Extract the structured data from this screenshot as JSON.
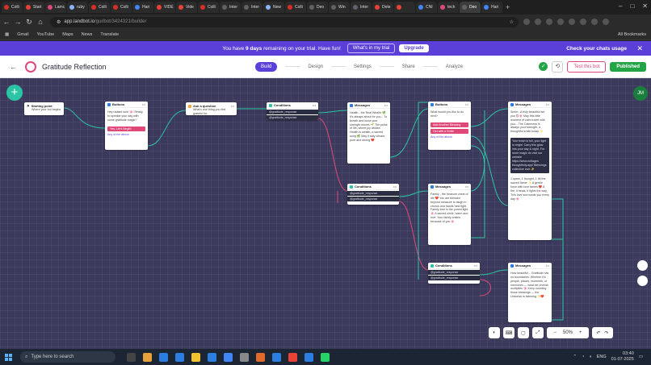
{
  "browser": {
    "tabs": [
      {
        "label": "Colli",
        "color": "#d93025"
      },
      {
        "label": "Start",
        "color": "#ea4335"
      },
      {
        "label": "Lamc",
        "color": "#e0487a"
      },
      {
        "label": "ruby",
        "color": "#8ab4f8"
      },
      {
        "label": "Colli",
        "color": "#d93025"
      },
      {
        "label": "Colli",
        "color": "#d93025"
      },
      {
        "label": "Hari",
        "color": "#4285f4"
      },
      {
        "label": "VIDE",
        "color": "#ea4335"
      },
      {
        "label": "Vide",
        "color": "#ea4335"
      },
      {
        "label": "Colli",
        "color": "#d93025"
      },
      {
        "label": "Inter",
        "color": "#5f6368"
      },
      {
        "label": "Inter",
        "color": "#5f6368"
      },
      {
        "label": "New",
        "color": "#8ab4f8"
      },
      {
        "label": "Colli",
        "color": "#d93025"
      },
      {
        "label": "Deo",
        "color": "#5f6368"
      },
      {
        "label": "Win",
        "color": "#5f6368"
      },
      {
        "label": "Inter",
        "color": "#5f6368"
      },
      {
        "label": "Dete",
        "color": "#ea4335"
      },
      {
        "label": "",
        "color": "#ea4335"
      },
      {
        "label": "CNI",
        "color": "#4285f4"
      },
      {
        "label": "tech",
        "color": "#e0487a"
      },
      {
        "label": "Deo",
        "color": "#5f6368"
      },
      {
        "label": "Hari",
        "color": "#4285f4"
      }
    ],
    "url_host": "app.landbot.io",
    "url_path": "/gui/bot/3424321/builder",
    "bookmarks": [
      "Gmail",
      "YouTube",
      "Maps",
      "News",
      "Translate"
    ],
    "all_bookmarks": "All Bookmarks"
  },
  "banner": {
    "text_pre": "You have ",
    "days": "9 days",
    "text_post": " remaining on your trial. Have fun!",
    "trial_button": "What's in my trial",
    "upgrade_button": "Upgrade",
    "check_usage": "Check your chats usage"
  },
  "header": {
    "title": "Gratitude Reflection",
    "steps": [
      "Build",
      "Design",
      "Settings",
      "Share",
      "Analyze"
    ],
    "test_button": "Test this bot",
    "publish_button": "Published"
  },
  "nodes": {
    "start": {
      "title": "Starting point",
      "body": "Where your bot begins"
    },
    "buttons1": {
      "title": "Buttons",
      "body": "Hey radiant soul 🌸! Ready to sprinkle your day with some gratitude magic?",
      "button": "Yes, Let's Begin!",
      "any": "Any of the above"
    },
    "ask": {
      "title": "Ask a question",
      "body": "What's one thing you feel grateful for..."
    },
    "cond1": {
      "title": "Conditions",
      "rows": [
        "@gratitude_response",
        "@gratitude_response"
      ]
    },
    "msg1": {
      "title": "Messages",
      "body": "Health - the Real Wealth 🌿 It's always about for you... To breath and know your strength moves 🌱 The pulse of life, where joy abides. Health is wealth, a sacred song 🌿 May it stay vibrant, pure and strong ❤️"
    },
    "buttons2": {
      "title": "Buttons",
      "body": "What would you like to do next?",
      "buttons": [
        "Add Another Blessing",
        "Get with a Smile"
      ],
      "any": "Any of the above"
    },
    "msg2": {
      "title": "Messages",
      "body": "Smile - A truly beautiful act you 😊🌸 May this little moment of calm travel with you... The Calmness is always your strength, a thoughtful smile today ✨",
      "dark": "Your heart is full, your light is bright. Carry this glow into your day & night. For more magic do visit our website https://www.writages thoughtfully.app/ Blessings collective love ✨",
      "footer": "1 spark, 1 thought, 1 bit the sacred flame ✨ A gentle force with love tames ❤️ A fire, it heals, it lights the way, This love surrounds you every day 🌸"
    },
    "cond2": {
      "title": "Conditions",
      "rows": [
        "@gratitude_response",
        "@gratitude_response"
      ]
    },
    "msg3": {
      "title": "Messages",
      "body": "Family - the treasure chest of life ❤️ You are blessed beyond measure to laugh in chorus and hands held tight. Family love is the purest light 🌸 A sacred circle, warm and true. Your family smiles because of you 🌸"
    },
    "cond3": {
      "title": "Conditions",
      "rows": [
        "@gratitude_response",
        "@gratitude_response"
      ]
    },
    "msg4": {
      "title": "Messages",
      "body": "How beautiful... Gratitude has no boundaries. Whether it's people, places, moments, or memories — what we cherish multiplies 🌸 Keep counting those blessings — the Universe is listening ✨❤️"
    }
  },
  "zoom": "50%",
  "user_initials": "JM",
  "taskbar": {
    "search_placeholder": "Type here to search",
    "lang": "ENG",
    "time": "03:40",
    "date": "01-07-2025"
  },
  "colors": {
    "accent": "#5b3fd9",
    "pink": "#e0487a",
    "green": "#22a447",
    "canvas": "#3c3a5c",
    "teal": "#2bc4a4"
  }
}
